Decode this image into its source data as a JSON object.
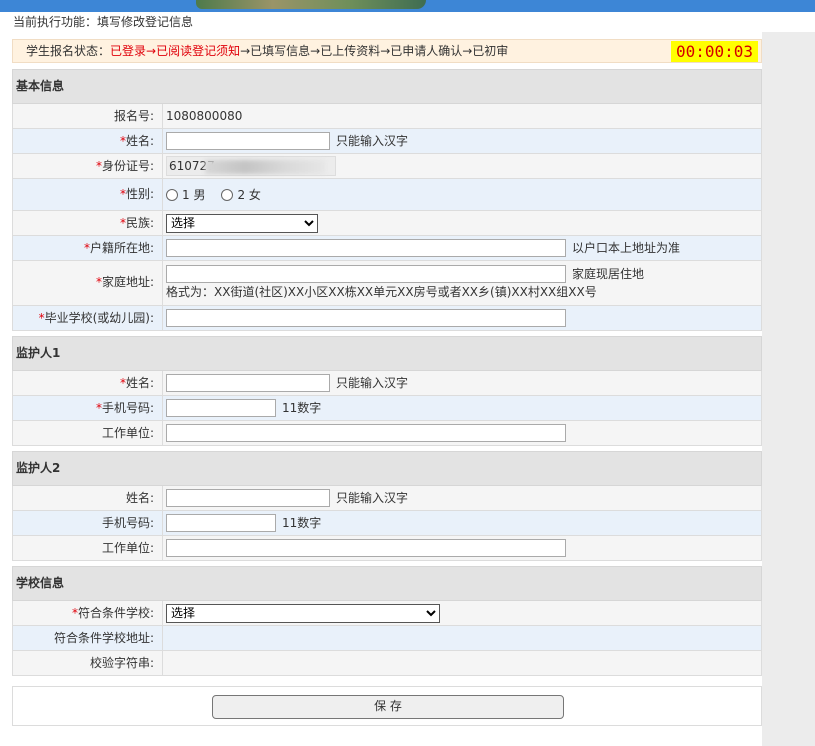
{
  "funcbar": {
    "text": "当前执行功能：填写修改登记信息"
  },
  "status": {
    "label": "学生报名状态：",
    "steps_red": "已登录→已阅读登记须知",
    "steps_rest": "→已填写信息→已上传资料→已申请人确认→已初审",
    "timer": "00:00:03"
  },
  "basic": {
    "title": "基本信息",
    "reg_no_label": "报名号:",
    "reg_no": "1080800080",
    "name_label": "姓名:",
    "name_hint": "只能输入汉字",
    "id_label": "身份证号:",
    "id_value": "610727",
    "gender_label": "性别:",
    "gender_male": "1 男",
    "gender_female": "2 女",
    "nation_label": "民族:",
    "nation_select": "选择",
    "hukou_label": "户籍所在地:",
    "hukou_hint": "以户口本上地址为准",
    "home_label": "家庭地址:",
    "home_hint": "家庭现居住地",
    "home_format": "格式为：XX街道(社区)XX小区XX栋XX单元XX房号或者XX乡(镇)XX村XX组XX号",
    "school_label": "毕业学校(或幼儿园):"
  },
  "guardian1": {
    "title": "监护人1",
    "name_label": "姓名:",
    "name_hint": "只能输入汉字",
    "phone_label": "手机号码:",
    "phone_hint": "11数字",
    "work_label": "工作单位:"
  },
  "guardian2": {
    "title": "监护人2",
    "name_label": "姓名:",
    "name_hint": "只能输入汉字",
    "phone_label": "手机号码:",
    "phone_hint": "11数字",
    "work_label": "工作单位:"
  },
  "school": {
    "title": "学校信息",
    "select_label": "符合条件学校:",
    "select_value": "选择",
    "address_label": "符合条件学校地址:",
    "checksum_label": "校验字符串:"
  },
  "save_label": "保 存",
  "required_mark": "*"
}
